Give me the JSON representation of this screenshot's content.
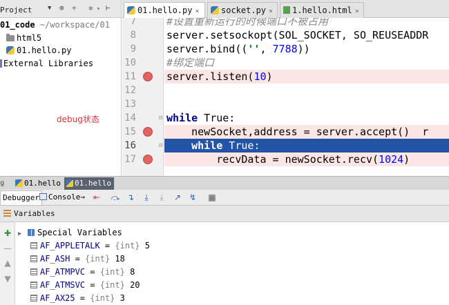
{
  "project": {
    "title": "Project",
    "root_name": "01_code",
    "root_path": "~/workspace/01",
    "items": [
      {
        "label": "html5",
        "icon": "folder-icon"
      },
      {
        "label": "01.hello.py",
        "icon": "python-file-icon"
      },
      {
        "label": "External Libraries",
        "icon": "library-icon"
      }
    ]
  },
  "annotation": "debug状态",
  "editor": {
    "tabs": [
      {
        "label": "01.hello.py",
        "icon": "python-file-icon",
        "active": true
      },
      {
        "label": "socket.py",
        "icon": "python-file-icon",
        "active": false
      },
      {
        "label": "1.hello.html",
        "icon": "html-file-icon",
        "active": false
      }
    ],
    "close_glyph": "×",
    "lines": [
      {
        "num": "7",
        "text": "#设置重新运行的时候端口不被占用"
      },
      {
        "num": "8",
        "text": "server.setsockopt(SOL_SOCKET, SO_REUSEADDR"
      },
      {
        "num": "9a",
        "text": "server.bind((",
        "str": "''",
        "tail": ", ",
        "num2": "7788",
        "end": "))"
      },
      {
        "num": "10",
        "text": "#绑定端口"
      },
      {
        "num": "11",
        "text": "server.listen(",
        "num2": "10",
        "end": ")"
      },
      {
        "num": "12",
        "text": ""
      },
      {
        "num": "13",
        "text": ""
      },
      {
        "num": "14",
        "kw": "while",
        "text": " True:"
      },
      {
        "num": "15",
        "text": "    newSocket,address = server.accept()  r"
      },
      {
        "num": "16",
        "kw": "while",
        "text": " True:"
      },
      {
        "num": "17",
        "text": "        recvData = newSocket.recv(",
        "num2": "1024",
        "end": ")"
      }
    ],
    "line_numbers": [
      "7",
      "8",
      "9",
      "10",
      "11",
      "12",
      "13",
      "14",
      "15",
      "16",
      "17"
    ]
  },
  "debug_tabs": [
    {
      "label": "01.hello",
      "active": false
    },
    {
      "label": "01.hello",
      "active": true
    }
  ],
  "debugger": {
    "debugger_tab": "Debugger",
    "console_tab": "Console",
    "console_arrow": "→",
    "variables_title": "Variables",
    "special": "Special Variables",
    "variables": [
      {
        "name": "AF_APPLETALK",
        "type": "{int}",
        "value": "5"
      },
      {
        "name": "AF_ASH",
        "type": "{int}",
        "value": "18"
      },
      {
        "name": "AF_ATMPVC",
        "type": "{int}",
        "value": "8"
      },
      {
        "name": "AF_ATMSVC",
        "type": "{int}",
        "value": "20"
      },
      {
        "name": "AF_AX25",
        "type": "{int}",
        "value": "3"
      }
    ]
  },
  "colors": {
    "current_line": "#2454a6",
    "breakpoint": "#e06666",
    "annotation": "#e0303a"
  }
}
